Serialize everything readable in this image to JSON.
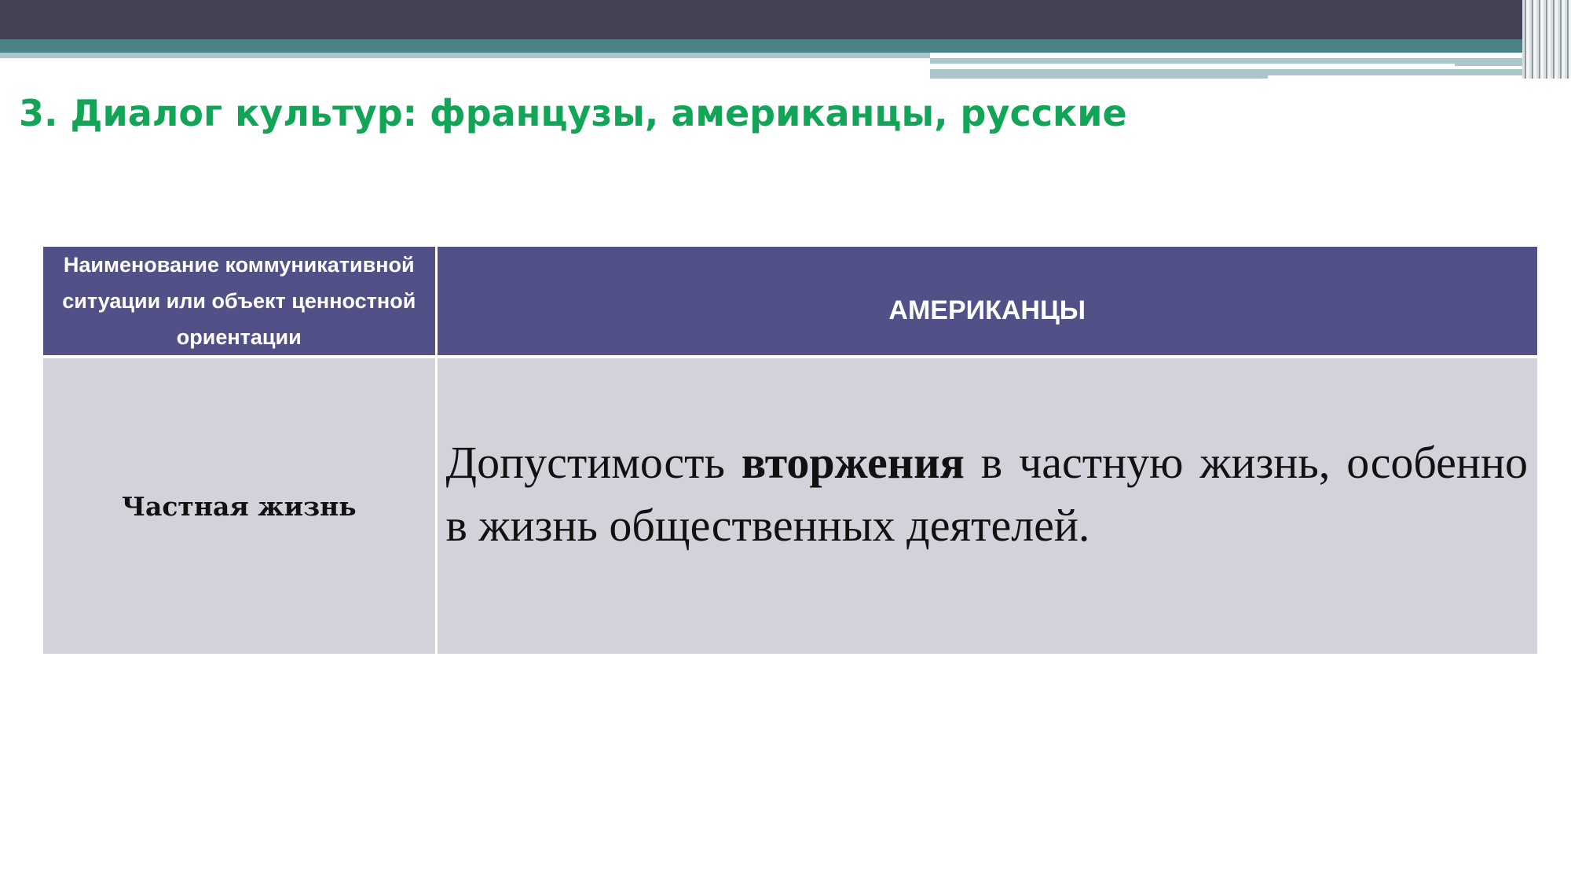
{
  "slide": {
    "title": "3. Диалог культур: французы, американцы, русские"
  },
  "table": {
    "header_left": "Наименование коммуникативной ситуации или объект ценностной ориентации",
    "header_right": "АМЕРИКАНЦЫ",
    "rows": [
      {
        "label": "Частная жизнь",
        "text_before": "Допустимость ",
        "text_bold": "вторжения",
        "text_after": " в частную жизнь, особенно в жизнь общественных деятелей."
      }
    ]
  },
  "colors": {
    "title": "#12a557",
    "header_bg": "#525187",
    "body_bg": "#d3d2db",
    "top_bar": "#434355",
    "accent_teal": "#4a8287"
  }
}
